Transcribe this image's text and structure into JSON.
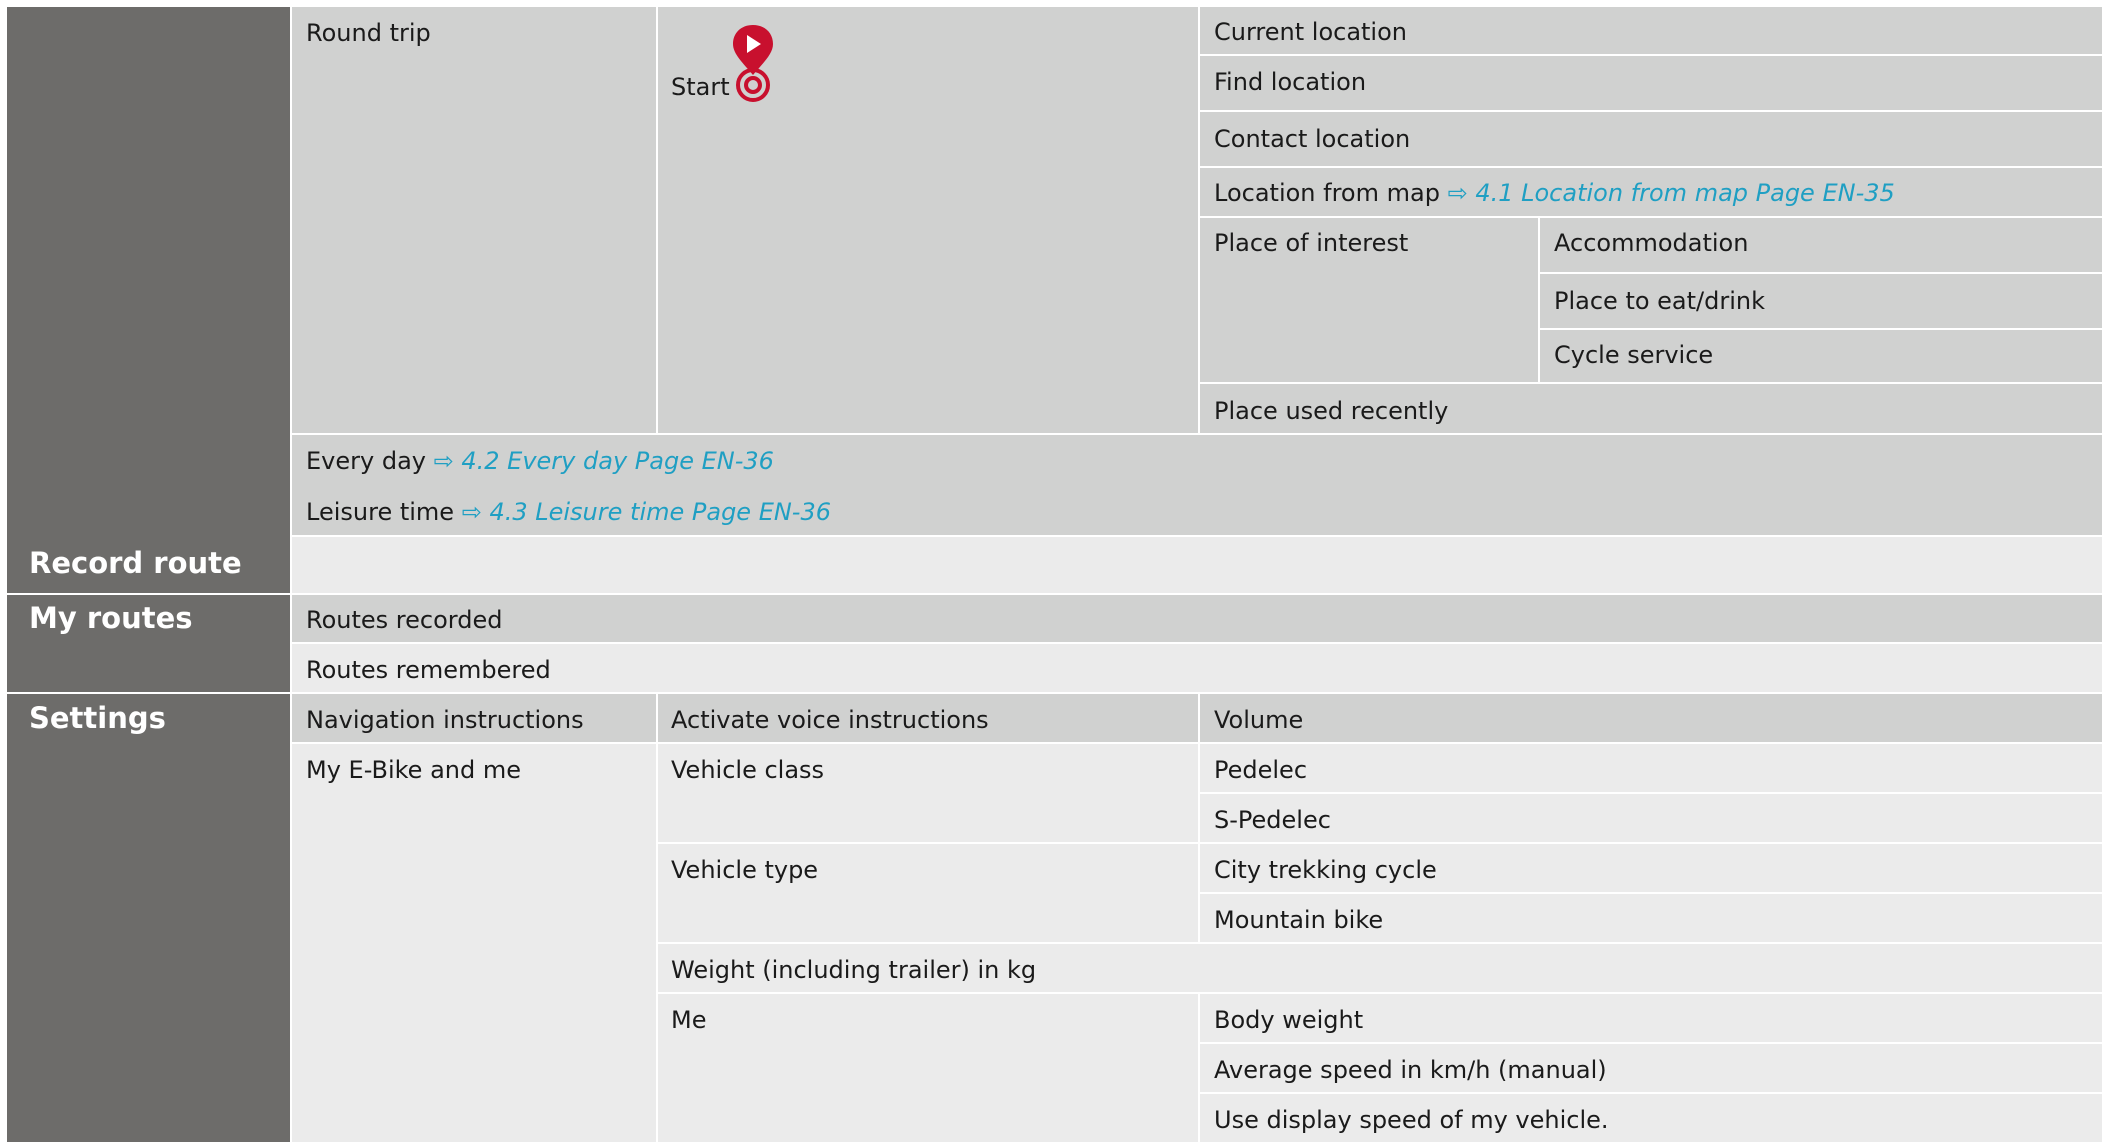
{
  "sections": {
    "record_route": "Record route",
    "my_routes": "My routes",
    "settings": "Settings"
  },
  "navigate": {
    "round_trip": "Round trip",
    "start_label": "Start",
    "start_options": {
      "current_location": "Current location",
      "find_location": "Find location",
      "contact_location": "Contact location",
      "location_from_map": "Location from map",
      "location_from_map_ref": "4.1 Location from map Page EN-35",
      "place_of_interest": "Place of interest",
      "poi_options": [
        "Accommodation",
        "Place to eat/drink",
        "Cycle service"
      ],
      "place_used_recently": "Place used recently"
    },
    "every_day": "Every day",
    "every_day_ref": "4.2 Every day Page EN-36",
    "leisure_time": "Leisure time",
    "leisure_time_ref": "4.3 Leisure time Page EN-36",
    "arrow": "⇨"
  },
  "my_routes": {
    "routes_recorded": "Routes recorded",
    "routes_remembered": "Routes remembered"
  },
  "settings": {
    "navigation_instructions": "Navigation instructions",
    "activate_voice_instructions": "Activate voice instructions",
    "volume": "Volume",
    "my_ebike_and_me": "My E-Bike and me",
    "vehicle_class": "Vehicle class",
    "vehicle_class_options": [
      "Pedelec",
      "S-Pedelec"
    ],
    "vehicle_type": "Vehicle type",
    "vehicle_type_options": [
      "City trekking cycle",
      "Mountain bike"
    ],
    "weight_trailer": "Weight (including trailer) in kg",
    "me": "Me",
    "me_options": [
      "Body weight",
      "Average speed in km/h (manual)",
      "Use display speed of my vehicle."
    ]
  },
  "colors": {
    "dark": "#6d6c6a",
    "mid": "#d0d1d0",
    "light": "#ebebeb",
    "link": "#1f9fc3",
    "pin": "#c8102e"
  },
  "icons": {
    "start_pin": "start-location-pin-icon"
  }
}
